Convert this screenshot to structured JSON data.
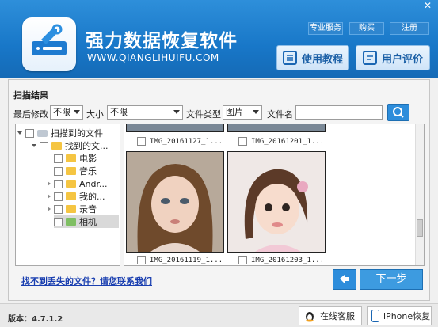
{
  "window": {
    "app_title": "强力数据恢复软件",
    "app_url": "WWW.QIANGLIHUIFU.COM",
    "controls": [
      "—",
      "✕"
    ],
    "top_links": [
      "专业服务",
      "购买",
      "注册"
    ],
    "big_buttons": [
      {
        "label": "使用教程",
        "icon": "book-icon"
      },
      {
        "label": "用户评价",
        "icon": "comment-icon"
      }
    ]
  },
  "scan": {
    "title": "扫描结果",
    "filters": {
      "modified_label": "最后修改",
      "modified_value": "不限",
      "size_label": "大小",
      "size_value": "不限",
      "type_label": "文件类型",
      "type_value": "图片",
      "name_label": "文件名",
      "name_value": ""
    },
    "tree": [
      {
        "label": "扫描到的文件",
        "level": 0
      },
      {
        "label": "找到的文...",
        "level": 1
      },
      {
        "label": "电影",
        "level": 2
      },
      {
        "label": "音乐",
        "level": 2
      },
      {
        "label": "Andr...",
        "level": 2
      },
      {
        "label": "我的...",
        "level": 2
      },
      {
        "label": "录音",
        "level": 2
      },
      {
        "label": "相机",
        "level": 2
      }
    ],
    "files": [
      {
        "name": "IMG_20161127_1..."
      },
      {
        "name": "IMG_20161201_1..."
      },
      {
        "name": "IMG_20161119_1..."
      },
      {
        "name": "IMG_20161203_1..."
      }
    ],
    "help_link": "找不到丢失的文件？请您联系我们",
    "next_label": "下一步"
  },
  "footer": {
    "version": "版本：4.7.1.2",
    "online_service": "在线客服",
    "iphone_recovery": "iPhone恢复"
  },
  "colors": {
    "header": "#1877c8",
    "accent": "#2d8ddb",
    "link": "#1a3fb0"
  }
}
